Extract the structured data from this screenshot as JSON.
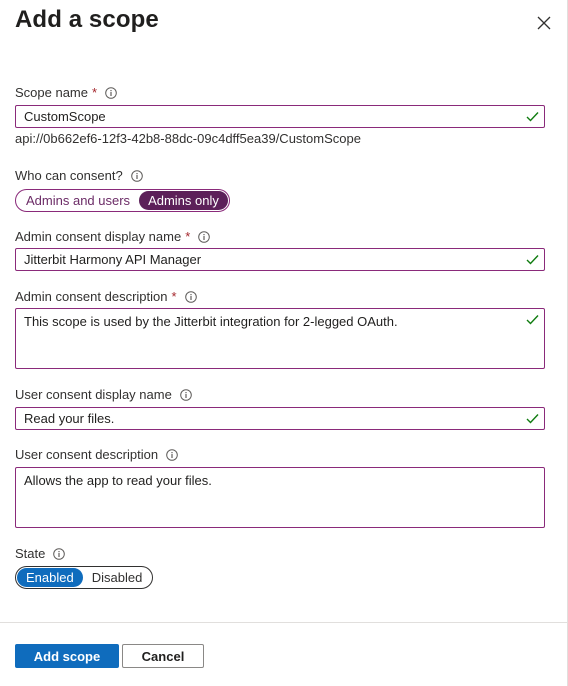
{
  "panel": {
    "title": "Add a scope"
  },
  "scope_name": {
    "label": "Scope name",
    "required": "*",
    "value": "CustomScope",
    "uri": "api://0b662ef6-12f3-42b8-88dc-09c4dff5ea39/CustomScope"
  },
  "consent": {
    "label": "Who can consent?",
    "options": [
      "Admins and users",
      "Admins only"
    ],
    "selected": "Admins only"
  },
  "admin_display_name": {
    "label": "Admin consent display name",
    "required": "*",
    "value": "Jitterbit Harmony API Manager"
  },
  "admin_description": {
    "label": "Admin consent description",
    "required": "*",
    "value": "This scope is used by the Jitterbit integration for 2-legged OAuth."
  },
  "user_display_name": {
    "label": "User consent display name",
    "value": "Read your files."
  },
  "user_description": {
    "label": "User consent description",
    "value": "Allows the app to read your files."
  },
  "state": {
    "label": "State",
    "options": [
      "Enabled",
      "Disabled"
    ],
    "selected": "Enabled"
  },
  "footer": {
    "add_label": "Add scope",
    "cancel_label": "Cancel"
  },
  "colors": {
    "accent_purple": "#5c2059",
    "primary_blue": "#0f6cbd",
    "valid_green": "#107c10",
    "required_red": "#a4262c"
  }
}
